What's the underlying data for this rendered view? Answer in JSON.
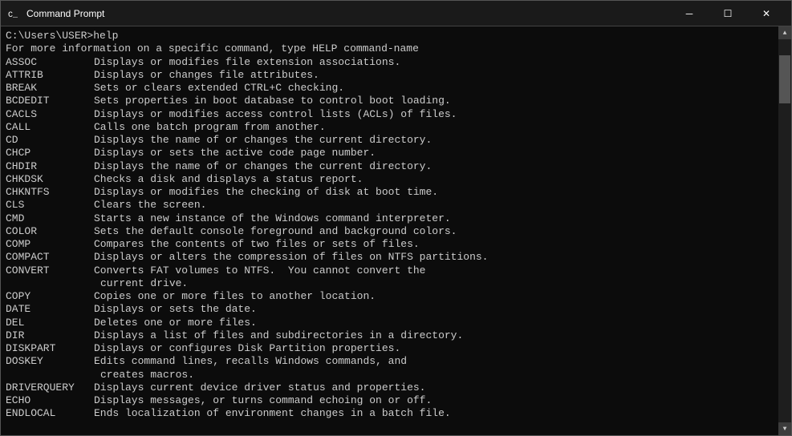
{
  "window": {
    "title": "Command Prompt",
    "icon": "CMD"
  },
  "controls": {
    "minimize": "─",
    "maximize": "☐",
    "close": "✕"
  },
  "terminal": {
    "prompt": "C:\\Users\\USER>help",
    "intro": "For more information on a specific command, type HELP command-name",
    "commands": [
      {
        "name": "ASSOC",
        "desc": "Displays or modifies file extension associations."
      },
      {
        "name": "ATTRIB",
        "desc": "Displays or changes file attributes."
      },
      {
        "name": "BREAK",
        "desc": "Sets or clears extended CTRL+C checking."
      },
      {
        "name": "BCDEDIT",
        "desc": "Sets properties in boot database to control boot loading."
      },
      {
        "name": "CACLS",
        "desc": "Displays or modifies access control lists (ACLs) of files."
      },
      {
        "name": "CALL",
        "desc": "Calls one batch program from another."
      },
      {
        "name": "CD",
        "desc": "Displays the name of or changes the current directory."
      },
      {
        "name": "CHCP",
        "desc": "Displays or sets the active code page number."
      },
      {
        "name": "CHDIR",
        "desc": "Displays the name of or changes the current directory."
      },
      {
        "name": "CHKDSK",
        "desc": "Checks a disk and displays a status report."
      },
      {
        "name": "CHKNTFS",
        "desc": "Displays or modifies the checking of disk at boot time."
      },
      {
        "name": "CLS",
        "desc": "Clears the screen."
      },
      {
        "name": "CMD",
        "desc": "Starts a new instance of the Windows command interpreter."
      },
      {
        "name": "COLOR",
        "desc": "Sets the default console foreground and background colors."
      },
      {
        "name": "COMP",
        "desc": "Compares the contents of two files or sets of files."
      },
      {
        "name": "COMPACT",
        "desc": "Displays or alters the compression of files on NTFS partitions."
      },
      {
        "name": "CONVERT",
        "desc": "Converts FAT volumes to NTFS.  You cannot convert the\n              current drive."
      },
      {
        "name": "COPY",
        "desc": "Copies one or more files to another location."
      },
      {
        "name": "DATE",
        "desc": "Displays or sets the date."
      },
      {
        "name": "DEL",
        "desc": "Deletes one or more files."
      },
      {
        "name": "DIR",
        "desc": "Displays a list of files and subdirectories in a directory."
      },
      {
        "name": "DISKPART",
        "desc": "Displays or configures Disk Partition properties."
      },
      {
        "name": "DOSKEY",
        "desc": "Edits command lines, recalls Windows commands, and\n              creates macros."
      },
      {
        "name": "DRIVERQUERY",
        "desc": "Displays current device driver status and properties."
      },
      {
        "name": "ECHO",
        "desc": "Displays messages, or turns command echoing on or off."
      },
      {
        "name": "ENDLOCAL",
        "desc": "Ends localization of environment changes in a batch file."
      }
    ]
  }
}
